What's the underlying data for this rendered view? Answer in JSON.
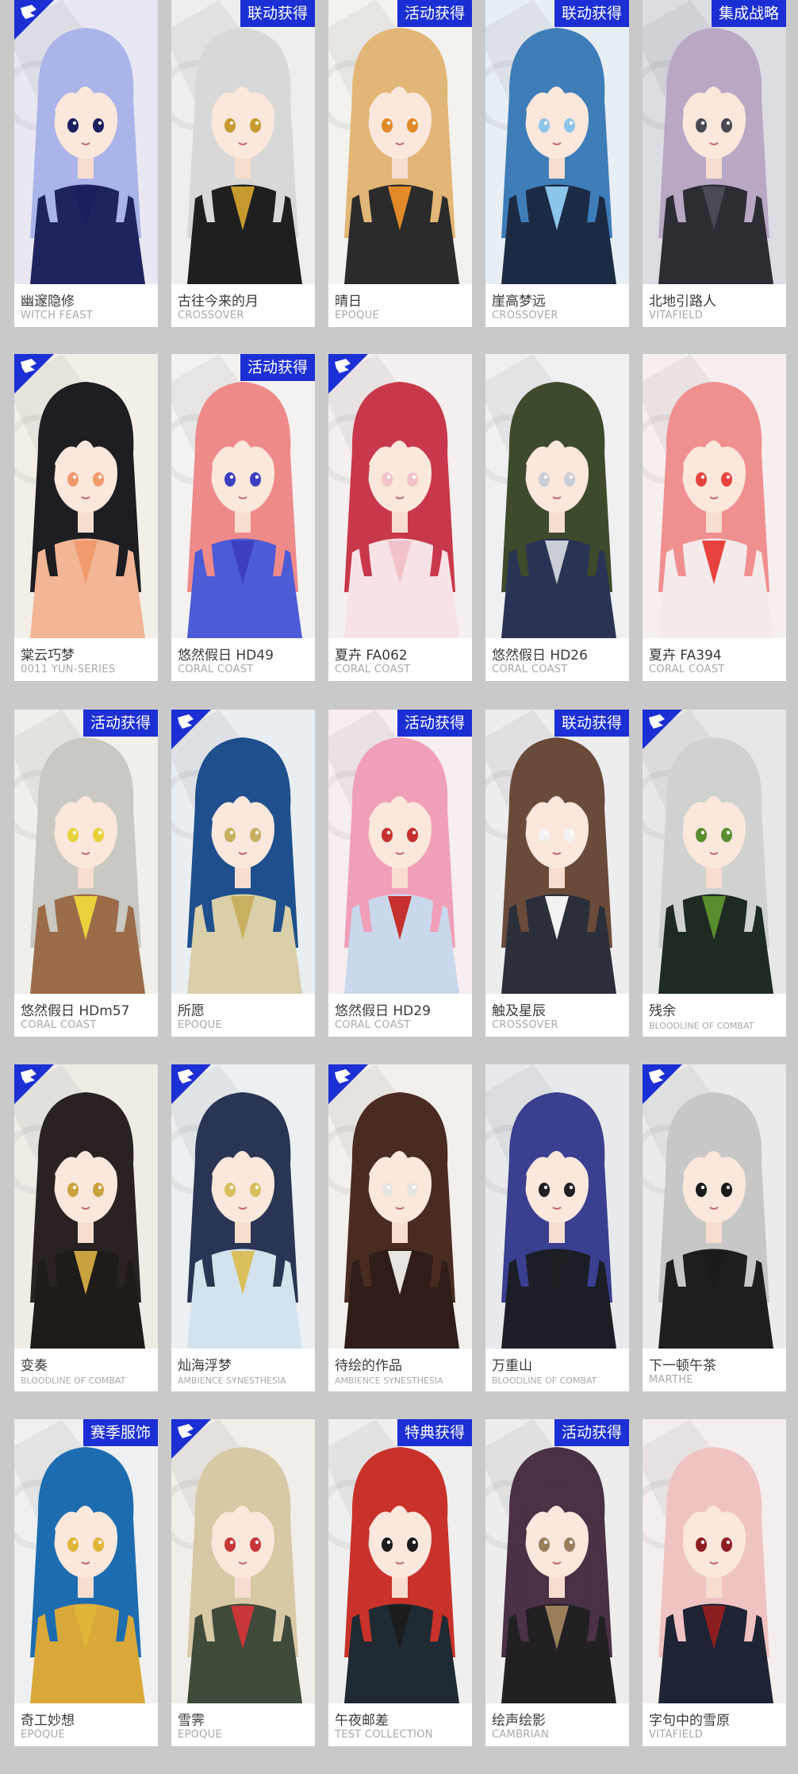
{
  "cards": [
    {
      "name": "幽邃隐修",
      "series": "WITCH FEAST",
      "badge": "",
      "icon": "operator-icon",
      "palette": {
        "bg": "#e9e8f2",
        "hair": "#aab4e8",
        "accent": "#1b1f5e",
        "body": "#20245e"
      }
    },
    {
      "name": "古往今来的月",
      "series": "CROSSOVER",
      "badge": "联动获得",
      "icon": "",
      "palette": {
        "bg": "#eeeeee",
        "hair": "#d8d8d8",
        "accent": "#c79a2f",
        "body": "#1f1f1f"
      }
    },
    {
      "name": "晴日",
      "series": "EPOQUE",
      "badge": "活动获得",
      "icon": "",
      "palette": {
        "bg": "#f4f2ee",
        "hair": "#e2b676",
        "accent": "#e08a2a",
        "body": "#2b2b2b"
      }
    },
    {
      "name": "崖高梦远",
      "series": "CROSSOVER",
      "badge": "联动获得",
      "icon": "",
      "palette": {
        "bg": "#e7eef4",
        "hair": "#3f7db8",
        "accent": "#8cc4ea",
        "body": "#1c2b44"
      }
    },
    {
      "name": "北地引路人",
      "series": "VITAFIELD",
      "badge": "集成战略",
      "icon": "",
      "palette": {
        "bg": "#dcdde3",
        "hair": "#b8a8c4",
        "accent": "#4a4a55",
        "body": "#2c2c33"
      }
    },
    {
      "name": "棠云巧梦",
      "series": "0011 YUN-SERIES",
      "badge": "",
      "icon": "operator-icon",
      "palette": {
        "bg": "#f3efe8",
        "hair": "#1d1d22",
        "accent": "#f09a6e",
        "body": "#f2b595"
      }
    },
    {
      "name": "悠然假日 HD49",
      "series": "CORAL COAST",
      "badge": "活动获得",
      "icon": "",
      "palette": {
        "bg": "#f4f1f1",
        "hair": "#ef8a8a",
        "accent": "#3c3fbf",
        "body": "#4c5bd6"
      }
    },
    {
      "name": "夏卉 FA062",
      "series": "CORAL COAST",
      "badge": "",
      "icon": "operator-icon",
      "palette": {
        "bg": "#f6efef",
        "hair": "#c8384a",
        "accent": "#f1c2c8",
        "body": "#f7e3e6"
      }
    },
    {
      "name": "悠然假日 HD26",
      "series": "CORAL COAST",
      "badge": "",
      "icon": "",
      "palette": {
        "bg": "#eef0f1",
        "hair": "#3e4a2c",
        "accent": "#c9cdd6",
        "body": "#2b3355"
      }
    },
    {
      "name": "夏卉 FA394",
      "series": "CORAL COAST",
      "badge": "",
      "icon": "",
      "palette": {
        "bg": "#f7eeee",
        "hair": "#f08f8f",
        "accent": "#e8423f",
        "body": "#f4eaea"
      }
    },
    {
      "name": "悠然假日 HDm57",
      "series": "CORAL COAST",
      "badge": "活动获得",
      "icon": "",
      "palette": {
        "bg": "#f1efe9",
        "hair": "#c9c8c2",
        "accent": "#e9d23c",
        "body": "#9b6c4a"
      }
    },
    {
      "name": "所愿",
      "series": "EPOQUE",
      "badge": "",
      "icon": "operator-icon",
      "palette": {
        "bg": "#e9eef2",
        "hair": "#1f4f8c",
        "accent": "#c8b060",
        "body": "#d9cfa9"
      }
    },
    {
      "name": "悠然假日 HD29",
      "series": "CORAL COAST",
      "badge": "活动获得",
      "icon": "",
      "palette": {
        "bg": "#f6eef1",
        "hair": "#f09fb8",
        "accent": "#c5312e",
        "body": "#c9d8ea"
      }
    },
    {
      "name": "触及星辰",
      "series": "CROSSOVER",
      "badge": "联动获得",
      "icon": "",
      "palette": {
        "bg": "#ecedef",
        "hair": "#6a4b3a",
        "accent": "#f2f2f2",
        "body": "#2a2f3a"
      }
    },
    {
      "name": "残余",
      "series": "BLOODLINE OF COMBAT",
      "badge": "",
      "icon": "operator-icon",
      "palette": {
        "bg": "#e6e8e6",
        "hair": "#cfd2d0",
        "accent": "#5a8d2e",
        "body": "#1f2a22"
      }
    },
    {
      "name": "变奏",
      "series": "BLOODLINE OF COMBAT",
      "badge": "",
      "icon": "operator-icon",
      "palette": {
        "bg": "#efece6",
        "hair": "#2a2222",
        "accent": "#c9a23f",
        "body": "#1e1b18"
      }
    },
    {
      "name": "灿海浮梦",
      "series": "AMBIENCE SYNESTHESIA",
      "badge": "",
      "icon": "operator-icon",
      "palette": {
        "bg": "#edf0f3",
        "hair": "#2a3553",
        "accent": "#d8bf5c",
        "body": "#d4e2ee"
      }
    },
    {
      "name": "待绘的作品",
      "series": "AMBIENCE SYNESTHESIA",
      "badge": "",
      "icon": "operator-icon",
      "palette": {
        "bg": "#f3efec",
        "hair": "#4a2b22",
        "accent": "#e8e4df",
        "body": "#2e1d18"
      }
    },
    {
      "name": "万重山",
      "series": "BLOODLINE OF COMBAT",
      "badge": "",
      "icon": "",
      "palette": {
        "bg": "#e8e9ec",
        "hair": "#3a3f8f",
        "accent": "#1e1e24",
        "body": "#1c1d25"
      }
    },
    {
      "name": "下一顿午茶",
      "series": "MARTHE",
      "badge": "",
      "icon": "operator-icon",
      "palette": {
        "bg": "#ebebeb",
        "hair": "#c7c7c7",
        "accent": "#1b1b1b",
        "body": "#1e1e1e"
      }
    },
    {
      "name": "奇工妙想",
      "series": "EPOQUE",
      "badge": "赛季服饰",
      "icon": "",
      "palette": {
        "bg": "#eef0f2",
        "hair": "#1e6cb0",
        "accent": "#e0b53a",
        "body": "#d8a93a"
      }
    },
    {
      "name": "雪霁",
      "series": "EPOQUE",
      "badge": "",
      "icon": "operator-icon",
      "palette": {
        "bg": "#f1eee9",
        "hair": "#d7c8a6",
        "accent": "#c8363a",
        "body": "#3f4a3a"
      }
    },
    {
      "name": "午夜邮差",
      "series": "TEST COLLECTION",
      "badge": "特典获得",
      "icon": "",
      "palette": {
        "bg": "#efefef",
        "hair": "#c8322a",
        "accent": "#1c1c1c",
        "body": "#1f2a33"
      }
    },
    {
      "name": "绘声绘影",
      "series": "CAMBRIAN",
      "badge": "活动获得",
      "icon": "",
      "palette": {
        "bg": "#eeedec",
        "hair": "#4a3144",
        "accent": "#9a7e5c",
        "body": "#232024"
      }
    },
    {
      "name": "字句中的雪原",
      "series": "VITAFIELD",
      "badge": "",
      "icon": "",
      "palette": {
        "bg": "#f4eeee",
        "hair": "#f0c3c3",
        "accent": "#8c1e22",
        "body": "#1e2433"
      }
    }
  ]
}
